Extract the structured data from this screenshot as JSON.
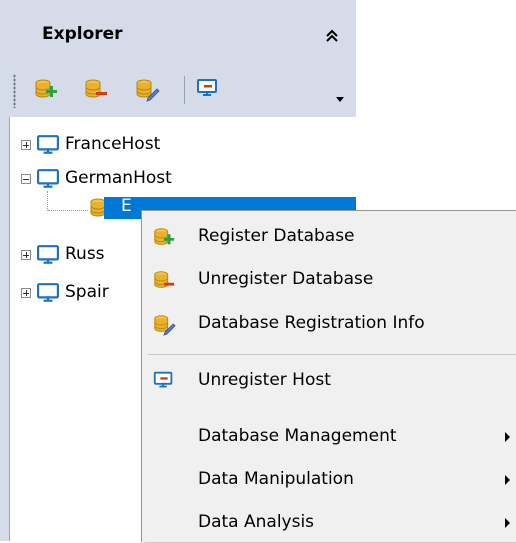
{
  "panel": {
    "title": "Explorer",
    "collapse_icon": "double-chevron-up-icon"
  },
  "toolbar": {
    "buttons": [
      {
        "name": "register-database-icon"
      },
      {
        "name": "unregister-database-icon"
      },
      {
        "name": "database-registration-info-icon"
      },
      {
        "name": "unregister-host-icon"
      }
    ],
    "dropdown_icon": "dropdown-arrow-icon"
  },
  "tree": {
    "nodes": [
      {
        "label": "FranceHost",
        "expanded": false
      },
      {
        "label": "GermanHost",
        "expanded": true
      },
      {
        "label": "Russ",
        "expanded": false
      },
      {
        "label": "Spair",
        "expanded": false
      }
    ],
    "selected_child": {
      "label": "E"
    }
  },
  "context_menu": {
    "items": [
      {
        "label": "Register Database",
        "icon": "register-database-icon"
      },
      {
        "label": "Unregister Database",
        "icon": "unregister-database-icon"
      },
      {
        "label": "Database Registration Info",
        "icon": "database-info-icon"
      },
      {
        "label": "Unregister Host",
        "icon": "unregister-host-icon"
      },
      {
        "label": "Database Management",
        "submenu": true
      },
      {
        "label": "Data Manipulation",
        "submenu": true
      },
      {
        "label": "Data Analysis",
        "submenu": true
      }
    ]
  },
  "colors": {
    "panel_bg": "#d6dbe9",
    "selection": "#0078d7",
    "db_gold": "#e8b028",
    "host_blue": "#1e73be"
  }
}
